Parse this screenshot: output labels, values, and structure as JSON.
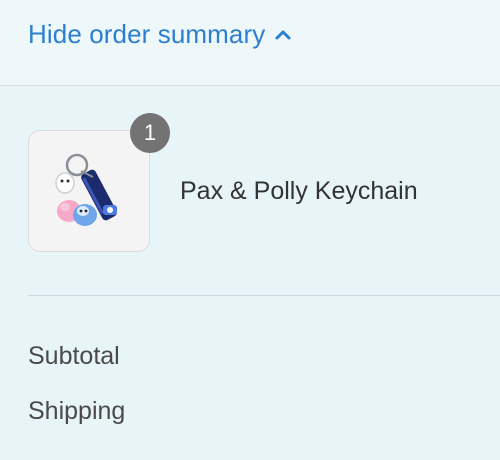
{
  "summary_toggle": {
    "label": "Hide order summary",
    "icon": "chevron-up-icon",
    "color": "#2c7fd0"
  },
  "line_items": [
    {
      "name": "Pax & Polly Keychain",
      "quantity": "1",
      "image_icon": "keychain-product-image"
    }
  ],
  "totals": {
    "subtotal_label": "Subtotal",
    "shipping_label": "Shipping"
  },
  "colors": {
    "panel_background": "#e7f4f8",
    "badge_background": "#737373",
    "accent": "#2c7fd0"
  }
}
